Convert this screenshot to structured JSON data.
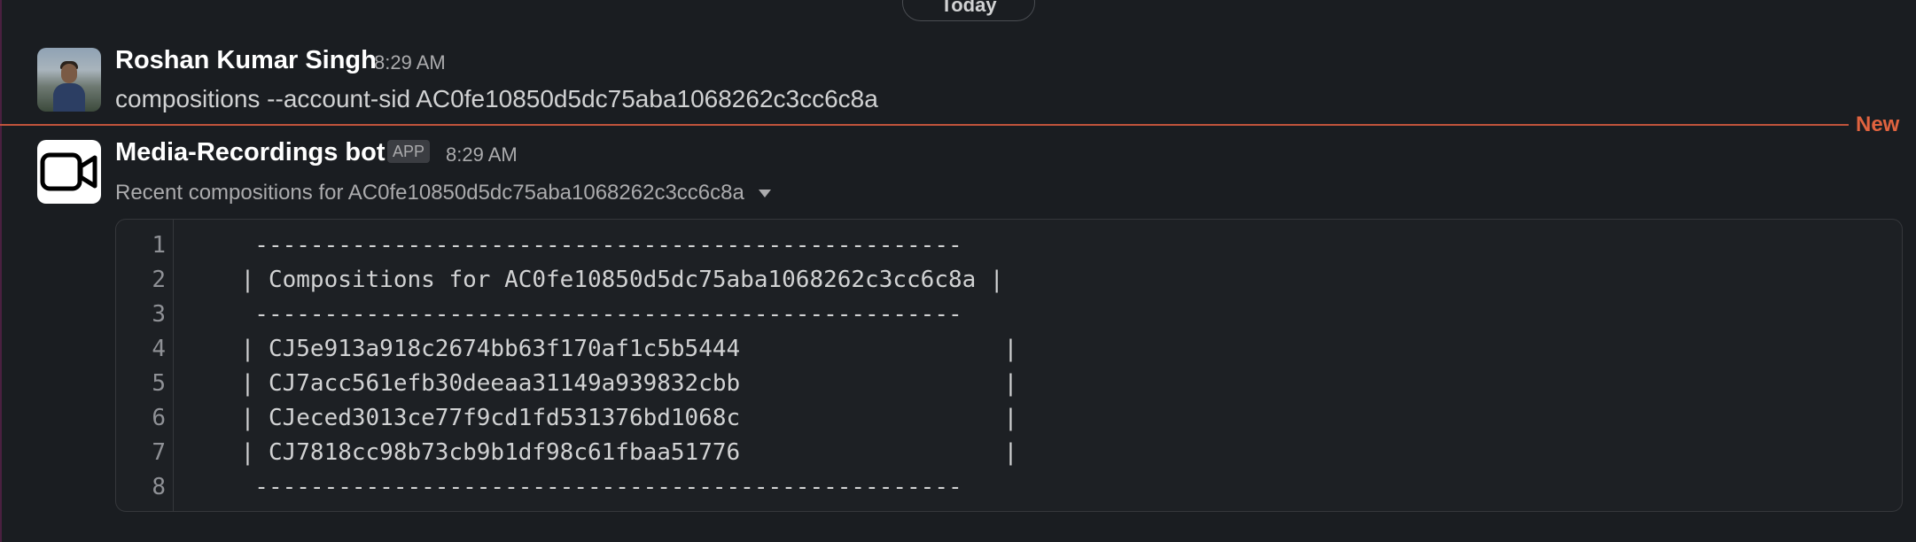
{
  "date_divider": "Today",
  "messages": [
    {
      "author": "Roshan Kumar Singh",
      "time": "8:29 AM",
      "text": "compositions --account-sid AC0fe10850d5dc75aba1068262c3cc6c8a"
    },
    {
      "author": "Media-Recordings bot",
      "badge": "APP",
      "time": "8:29 AM",
      "subtitle": "Recent compositions for AC0fe10850d5dc75aba1068262c3cc6c8a",
      "code_lines": [
        {
          "num": "1",
          "text": "  ---------------------------------------------------"
        },
        {
          "num": "2",
          "text": " | Compositions for AC0fe10850d5dc75aba1068262c3cc6c8a |"
        },
        {
          "num": "3",
          "text": "  ---------------------------------------------------"
        },
        {
          "num": "4",
          "text": " | CJ5e913a918c2674bb63f170af1c5b5444                   |"
        },
        {
          "num": "5",
          "text": " | CJ7acc561efb30deeaa31149a939832cbb                   |"
        },
        {
          "num": "6",
          "text": " | CJeced3013ce77f9cd1fd531376bd1068c                   |"
        },
        {
          "num": "7",
          "text": " | CJ7818cc98b73cb9b1df98c61fbaa51776                   |"
        },
        {
          "num": "8",
          "text": "  ---------------------------------------------------"
        }
      ]
    }
  ],
  "new_marker": "New",
  "icons": {
    "bot_avatar": "video-camera-icon",
    "subtitle_toggle": "caret-down-icon"
  },
  "colors": {
    "background": "#1a1d21",
    "new_marker": "#e0633f"
  }
}
